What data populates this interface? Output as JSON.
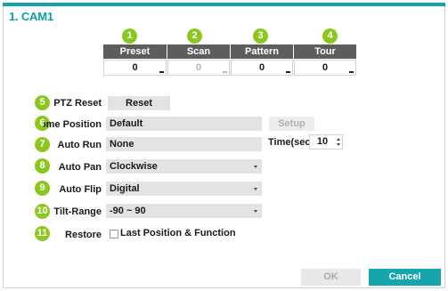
{
  "title": "1. CAM1",
  "colors": {
    "accent": "#12a4a9",
    "badge": "#8cc71f",
    "header_bg": "#5d5d5d",
    "field_bg": "#e3e3e3"
  },
  "columns": [
    {
      "badge": "1",
      "label": "Preset",
      "value": "0",
      "enabled": true
    },
    {
      "badge": "2",
      "label": "Scan",
      "value": "0",
      "enabled": false
    },
    {
      "badge": "3",
      "label": "Pattern",
      "value": "0",
      "enabled": true
    },
    {
      "badge": "4",
      "label": "Tour",
      "value": "0",
      "enabled": true
    }
  ],
  "ptz_reset": {
    "badge": "5",
    "label": "PTZ Reset",
    "button": "Reset"
  },
  "home_position": {
    "badge": "6",
    "label": "Home Position",
    "value": "Default",
    "button": "Setup"
  },
  "auto_run": {
    "badge": "7",
    "label": "Auto Run",
    "value": "None",
    "time_label": "Time(sec.)",
    "time_value": "10"
  },
  "auto_pan": {
    "badge": "8",
    "label": "Auto Pan",
    "value": "Clockwise"
  },
  "auto_flip": {
    "badge": "9",
    "label": "Auto Flip",
    "value": "Digital"
  },
  "tilt_range": {
    "badge": "10",
    "label": "Tilt-Range",
    "value": "-90 ~ 90"
  },
  "restore": {
    "badge": "11",
    "label": "Restore",
    "checkbox_label": "Last Position & Function",
    "checked": false
  },
  "footer": {
    "ok": "OK",
    "cancel": "Cancel"
  }
}
